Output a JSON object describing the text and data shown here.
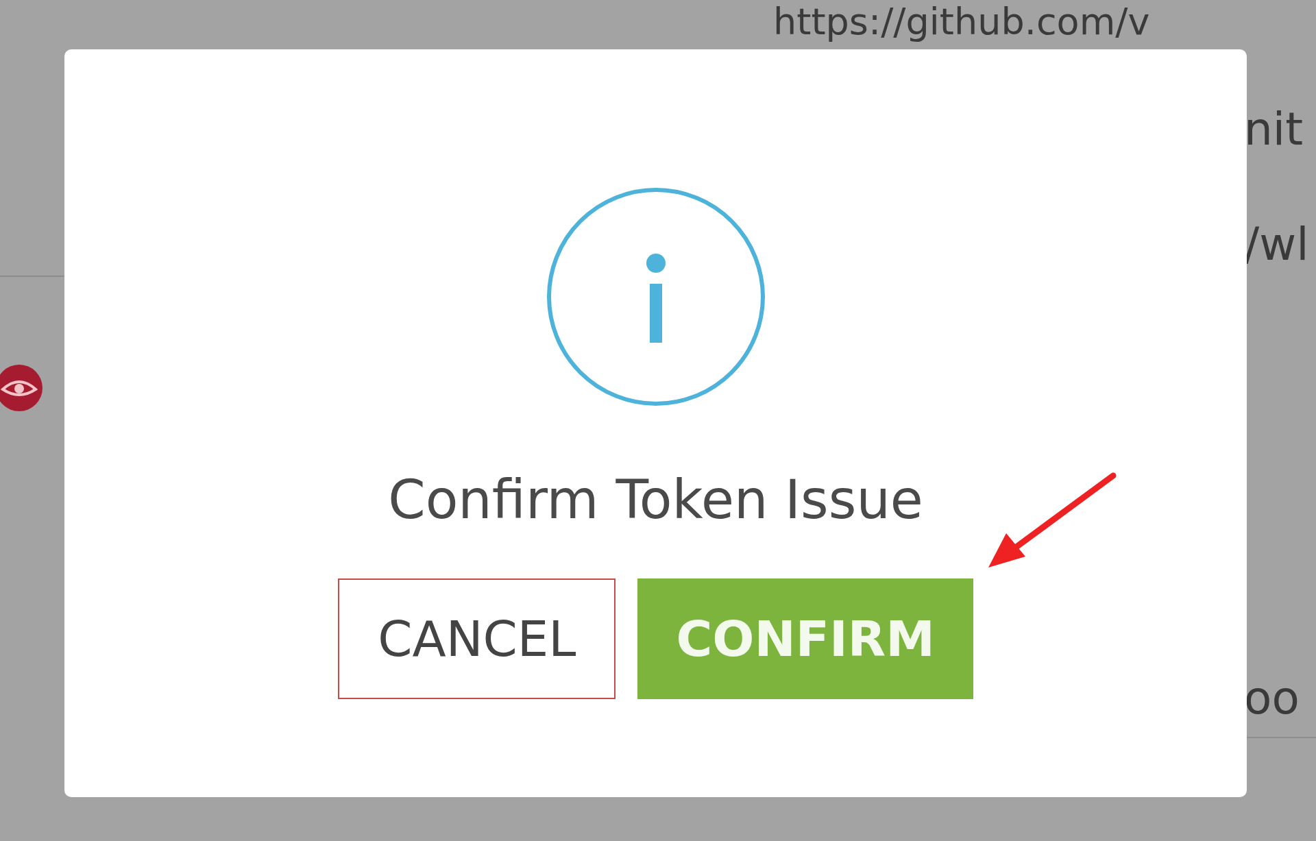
{
  "background": {
    "url_text": "https://github.com/v",
    "fragments": [
      "nit",
      "/wl",
      "oo"
    ]
  },
  "dialog": {
    "title": "Confirm Token Issue",
    "buttons": [
      {
        "label": "CANCEL",
        "kind": "secondary"
      },
      {
        "label": "CONFIRM",
        "kind": "primary"
      }
    ]
  }
}
